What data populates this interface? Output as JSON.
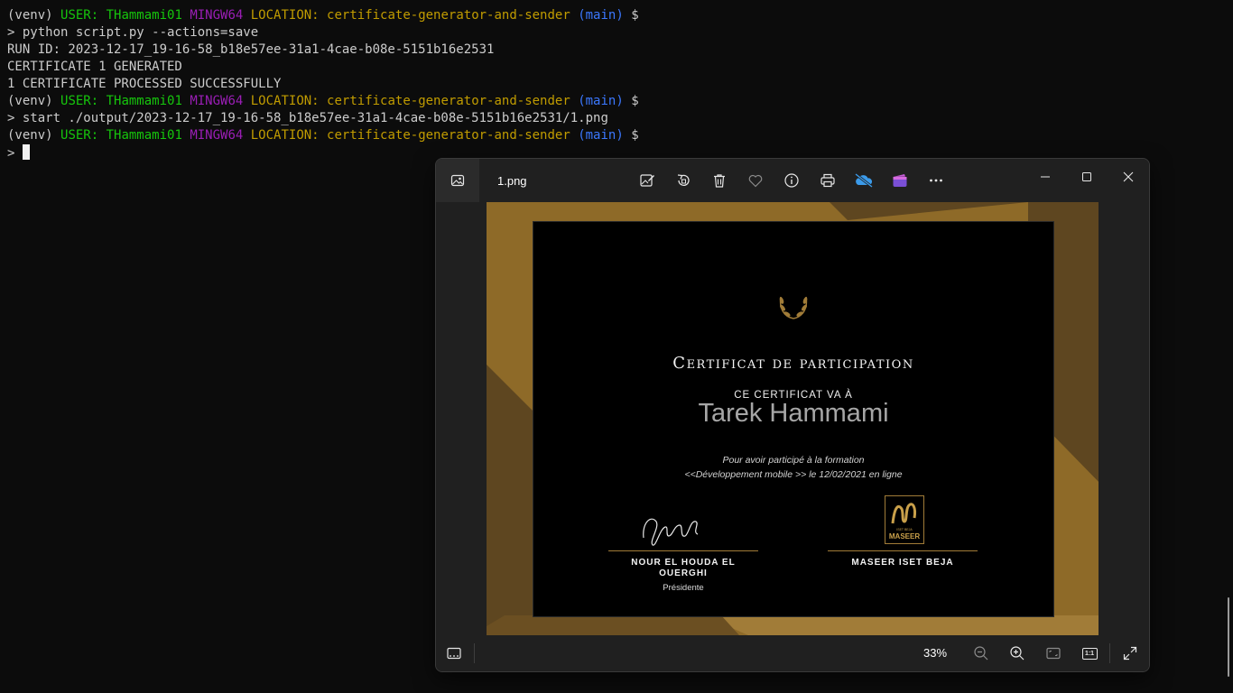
{
  "terminal": {
    "prompt": {
      "venv": "(venv) ",
      "user_label": "USER: ",
      "user": "THammami01 ",
      "system": "MINGW64 ",
      "location_label": "LOCATION: ",
      "location": "certificate-generator-and-sender ",
      "branch": "(main) ",
      "symbol": "$"
    },
    "commands": [
      "> python script.py --actions=save",
      "> start ./output/2023-12-17_19-16-58_b18e57ee-31a1-4cae-b08e-5151b16e2531/1.png"
    ],
    "output": [
      "RUN ID: 2023-12-17_19-16-58_b18e57ee-31a1-4cae-b08e-5151b16e2531",
      "CERTIFICATE 1 GENERATED",
      "1 CERTIFICATE PROCESSED SUCCESSFULLY"
    ],
    "input_prefix": "> "
  },
  "viewer": {
    "file_name": "1.png",
    "toolbar": [
      {
        "name": "edit-image-icon",
        "title": "Edit image"
      },
      {
        "name": "rotate-icon",
        "title": "Rotate"
      },
      {
        "name": "delete-icon",
        "title": "Delete"
      },
      {
        "name": "favorite-icon",
        "title": "Favorite"
      },
      {
        "name": "file-info-icon",
        "title": "File information"
      },
      {
        "name": "print-icon",
        "title": "Print"
      },
      {
        "name": "onedrive-icon",
        "title": "OneDrive"
      },
      {
        "name": "clipchamp-icon",
        "title": "Clipchamp"
      },
      {
        "name": "more-options-icon",
        "title": "See more"
      }
    ],
    "zoom": "33%",
    "ratio_label": "1:1"
  },
  "certificate": {
    "title": "Certificat de participation",
    "subtitle": "CE CERTIFICAT VA À",
    "recipient": "Tarek Hammami",
    "body_line1": "Pour avoir participé à la formation",
    "body_line2": "<<Développement mobile >> le 12/02/2021 en ligne",
    "signer_left_name_1": "NOUR EL HOUDA EL",
    "signer_left_name_2": "OUERGHI",
    "signer_left_role": "Présidente",
    "signer_right_name": "MASEER ISET BEJA",
    "logo_small": "ISET BEJA",
    "logo_text": "MASEER"
  },
  "colors": {
    "gold": "#8e6a28",
    "gold_dark": "#5e4620",
    "gold_light": "#a17c38",
    "green": "#16c60c",
    "purple": "#9a1eb5",
    "yellow": "#c19c00",
    "blue": "#3b78ff"
  }
}
